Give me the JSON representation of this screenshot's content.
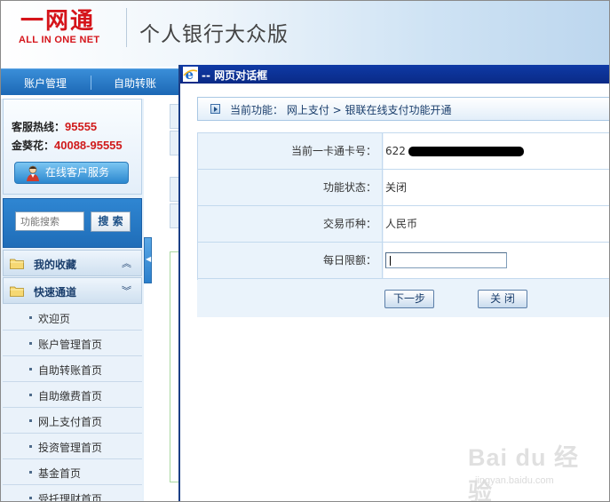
{
  "header": {
    "logo_text": "一网通",
    "logo_sub": "ALL IN ONE NET",
    "title": "个人银行大众版"
  },
  "nav": {
    "items": [
      {
        "label": "账户管理"
      },
      {
        "label": "自助转账"
      }
    ]
  },
  "sidebar": {
    "hotline": {
      "service_label": "客服热线：",
      "service_number": "95555",
      "gold_label": "金葵花：",
      "gold_number": "40088-95555",
      "online_service_label": "在线客户服务"
    },
    "search": {
      "placeholder": "功能搜索",
      "button_label": "搜 索"
    },
    "sections": [
      {
        "label": "我的收藏",
        "chevron": "︽"
      },
      {
        "label": "快速通道",
        "chevron": "︾"
      }
    ],
    "items": [
      {
        "label": "欢迎页"
      },
      {
        "label": "账户管理首页"
      },
      {
        "label": "自助转账首页"
      },
      {
        "label": "自助缴费首页"
      },
      {
        "label": "网上支付首页"
      },
      {
        "label": "投资管理首页"
      },
      {
        "label": "基金首页"
      },
      {
        "label": "受托理财首页"
      }
    ]
  },
  "dialog": {
    "title": "-- 网页对话框",
    "breadcrumb": "当前功能： 网上支付 > 银联在线支付功能开通",
    "rows": [
      {
        "label": "当前一卡通卡号：",
        "value": "622"
      },
      {
        "label": "功能状态：",
        "value": "关闭"
      },
      {
        "label": "交易币种：",
        "value": "人民币"
      },
      {
        "label": "每日限额：",
        "value": ""
      }
    ],
    "buttons": {
      "next": "下一步",
      "close": "关 闭"
    }
  },
  "watermark": {
    "main": "Bai du 经验",
    "sub": "jingyan.baidu.com"
  },
  "colors": {
    "brand_red": "#d5141a",
    "nav_blue": "#1c68b5",
    "dialog_title_blue": "#0a2a86"
  }
}
